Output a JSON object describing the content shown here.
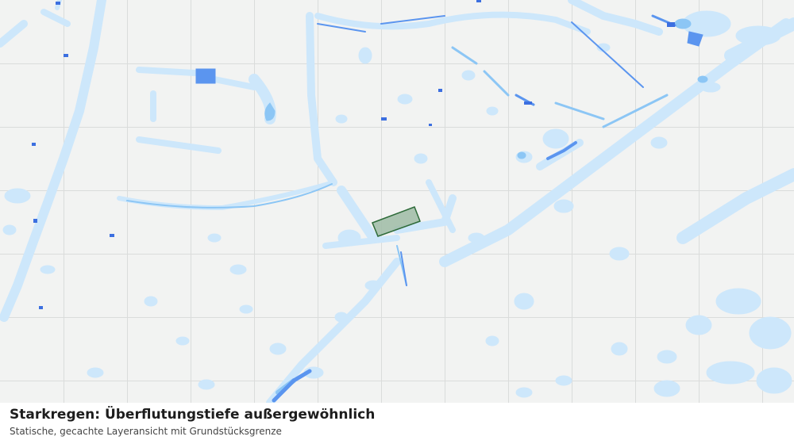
{
  "map": {
    "layer": "Starkregen: Überflutungstiefe außergewöhnlich",
    "colors": {
      "background": "#f2f3f2",
      "grid": "#dadcdb",
      "shallow": "#cde7fb",
      "medium": "#8cc6f5",
      "deep": "#5b95ef",
      "deepest": "#3c6fe0",
      "parcel_fill": "#9fbba6",
      "parcel_stroke": "#2e6b3a"
    }
  },
  "caption": {
    "title": "Starkregen: Überflutungstiefe außergewöhnlich",
    "subtitle": "Statische, gecachte Layeransicht mit Grundstücksgrenze"
  }
}
